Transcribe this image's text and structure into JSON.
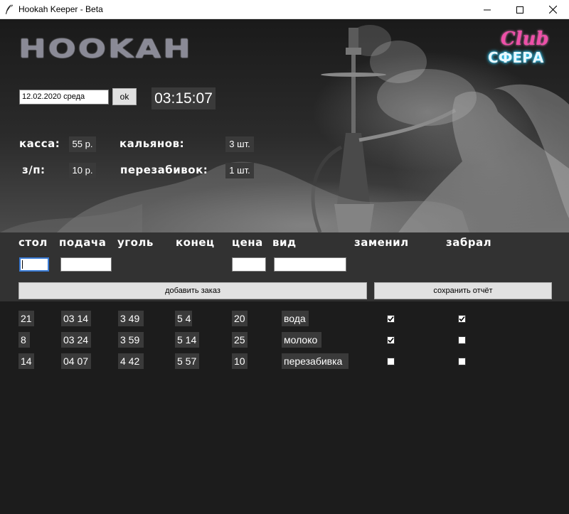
{
  "window": {
    "title": "Hookah Keeper - Beta",
    "icon": "feather-icon"
  },
  "header": {
    "logo_text": "HOOKAH",
    "club_text": "Club",
    "brand_text": "СФЕРА"
  },
  "datebar": {
    "date_value": "12.02.2020 среда",
    "ok_label": "ok",
    "clock": "03:15:07"
  },
  "stats": {
    "kassa_label": "касса:",
    "kassa_value": "55 р.",
    "hookahs_label": "кальянов:",
    "hookahs_value": "3 шт.",
    "salary_label": "з/п:",
    "salary_value": "10 р.",
    "refills_label": "перезабивок:",
    "refills_value": "1 шт."
  },
  "form": {
    "columns": {
      "table": "стол",
      "served": "подача",
      "coal": "уголь",
      "end": "конец",
      "price": "цена",
      "kind": "вид",
      "replaced": "заменил",
      "taken": "забрал"
    },
    "inputs": {
      "table": "",
      "served": "",
      "price": "",
      "kind": ""
    },
    "add_button": "добавить заказ",
    "save_button": "сохранить отчёт"
  },
  "orders": [
    {
      "table": "21",
      "served": "03 14",
      "coal": "3 49",
      "end": "5 4",
      "price": "20",
      "kind": "вода",
      "replaced": true,
      "taken": true
    },
    {
      "table": "8",
      "served": "03 24",
      "coal": "3 59",
      "end": "5 14",
      "price": "25",
      "kind": "молоко",
      "replaced": true,
      "taken": false
    },
    {
      "table": "14",
      "served": "04 07",
      "coal": "4 42",
      "end": "5 57",
      "price": "10",
      "kind": "перезабивка",
      "replaced": false,
      "taken": false
    }
  ]
}
